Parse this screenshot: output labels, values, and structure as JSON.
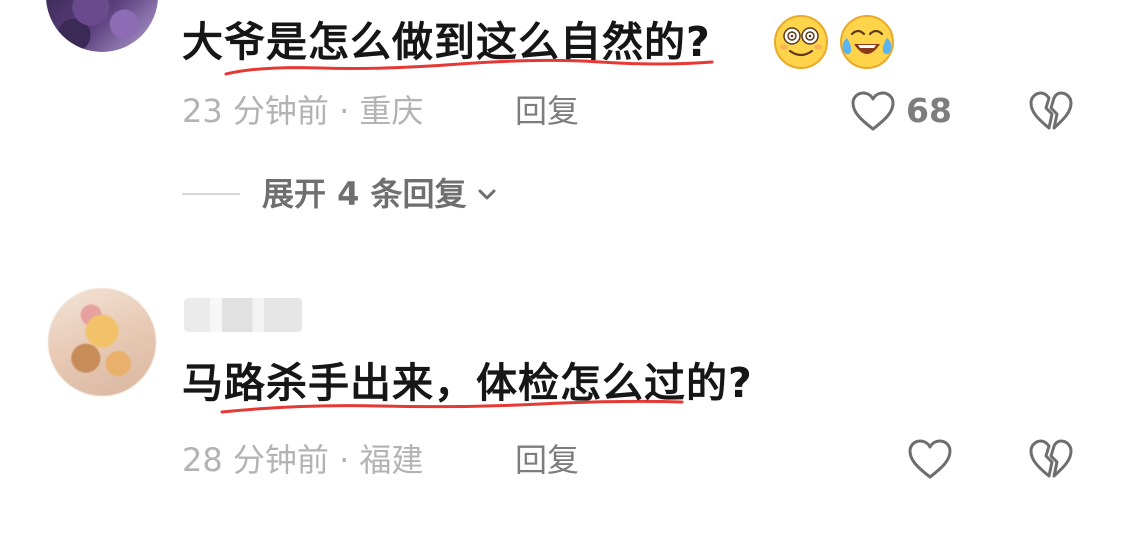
{
  "comments": [
    {
      "text": "大爷是怎么做到这么自然的?",
      "emojis": [
        "dizzy-eyes-face-emoji",
        "laughing-crying-face-emoji"
      ],
      "time": "23 分钟前",
      "separator": "·",
      "location": "重庆",
      "reply_label": "回复",
      "likes": "68"
    },
    {
      "text": "马路杀手出来，体检怎么过的?",
      "time": "28 分钟前",
      "separator": "·",
      "location": "福建",
      "reply_label": "回复"
    }
  ],
  "expand_replies": {
    "label": "展开 4 条回复"
  },
  "colors": {
    "text": "#161616",
    "meta": "#b3b3b3",
    "action": "#7d7d7d",
    "underline_annotation": "#e53935"
  }
}
